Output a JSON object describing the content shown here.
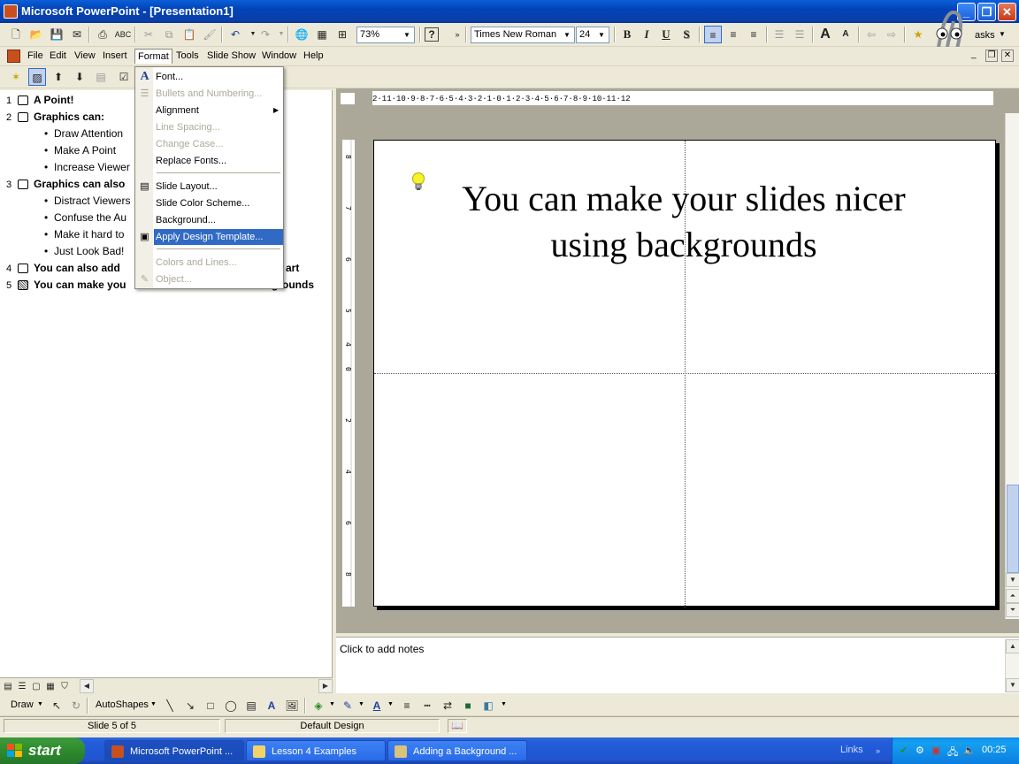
{
  "window": {
    "title": "Microsoft PowerPoint - [Presentation1]"
  },
  "toolbar": {
    "zoom": "73%",
    "font_name": "Times New Roman",
    "font_size": "24",
    "bold": "B",
    "italic": "I",
    "underline": "U",
    "shadow": "S",
    "tasks_label": "asks"
  },
  "menubar": {
    "items": [
      "File",
      "Edit",
      "View",
      "Insert",
      "Format",
      "Tools",
      "Slide Show",
      "Window",
      "Help"
    ]
  },
  "format_menu": {
    "items": [
      {
        "label": "Font...",
        "enabled": true
      },
      {
        "label": "Bullets and Numbering...",
        "enabled": false
      },
      {
        "label": "Alignment",
        "enabled": true
      },
      {
        "label": "Line Spacing...",
        "enabled": false
      },
      {
        "label": "Change Case...",
        "enabled": false
      },
      {
        "label": "Replace Fonts...",
        "enabled": true
      },
      {
        "label": "Slide Layout...",
        "enabled": true
      },
      {
        "label": "Slide Color Scheme...",
        "enabled": true
      },
      {
        "label": "Background...",
        "enabled": true
      },
      {
        "label": "Apply Design Template...",
        "enabled": true,
        "highlighted": true
      },
      {
        "label": "Colors and Lines...",
        "enabled": false
      },
      {
        "label": "Object...",
        "enabled": false
      }
    ]
  },
  "outline": {
    "rows": [
      {
        "num": "1",
        "text": "A Point!"
      },
      {
        "num": "2",
        "text": "Graphics can:"
      },
      {
        "text": "Draw Attention"
      },
      {
        "text": "Make A Point"
      },
      {
        "text": "Increase Viewer"
      },
      {
        "num": "3",
        "text": "Graphics can also"
      },
      {
        "text": "Distract Viewers"
      },
      {
        "text": "Confuse the Au"
      },
      {
        "text": "Make it hard to"
      },
      {
        "text": "Just Look Bad!"
      },
      {
        "num": "4",
        "text": "You can also add",
        "tail": "art"
      },
      {
        "num": "5",
        "text": "You can make you",
        "tail": "grounds"
      }
    ]
  },
  "slide": {
    "title_line1": "You can make your slides nicer",
    "title_line2": "using backgrounds"
  },
  "ruler": {
    "top": "2·11·10·9·8·7·6·5·4·3·2·1·0·1·2·3·4·5·6·7·8·9·10·11·12"
  },
  "notes": {
    "placeholder": "Click to add notes"
  },
  "drawbar": {
    "draw": "Draw",
    "autoshapes": "AutoShapes"
  },
  "status": {
    "slide": "Slide 5 of 5",
    "design": "Default Design"
  },
  "taskbar": {
    "start": "start",
    "tasks": [
      "Microsoft PowerPoint ...",
      "Lesson 4 Examples",
      "Adding a Background ..."
    ],
    "links": "Links",
    "time": "00:25"
  }
}
